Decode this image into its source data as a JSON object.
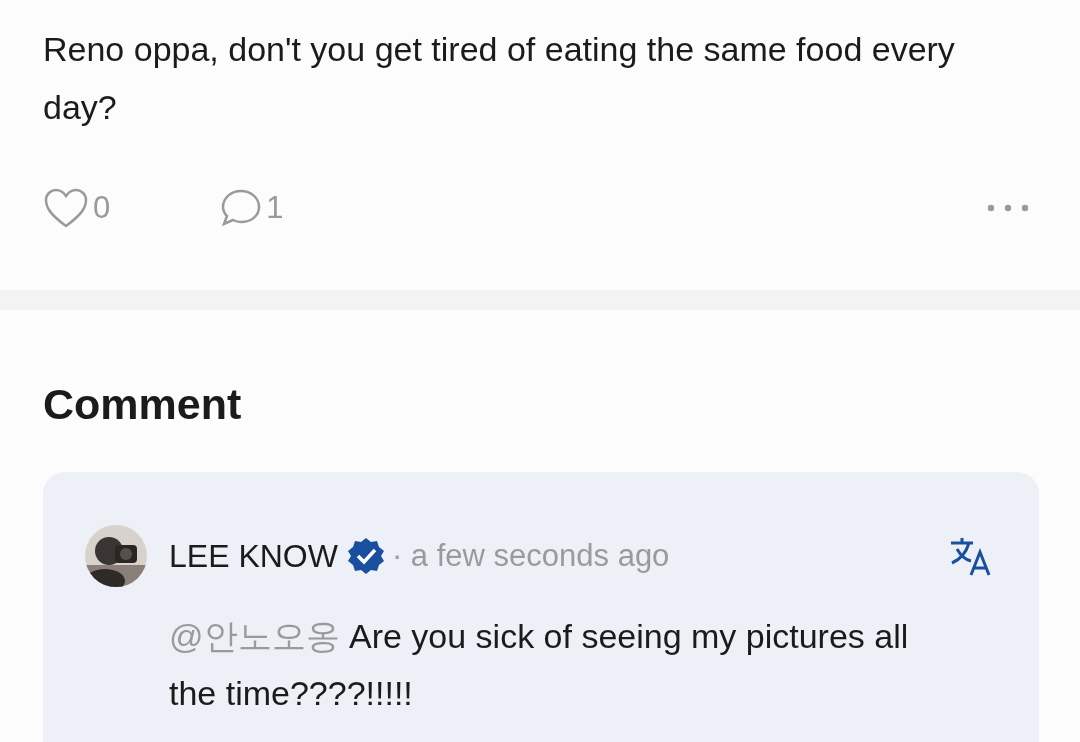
{
  "post": {
    "text": "Reno oppa, don't you get tired of eating the same food every day?",
    "likes": "0",
    "comments": "1"
  },
  "comments_section": {
    "title": "Comment",
    "comments": [
      {
        "author": "LEE KNOW",
        "verified": true,
        "time": "· a few seconds ago",
        "mention": "@안노오옹",
        "text": "Are you sick of seeing my pictures all the time????!!!!!"
      }
    ]
  }
}
